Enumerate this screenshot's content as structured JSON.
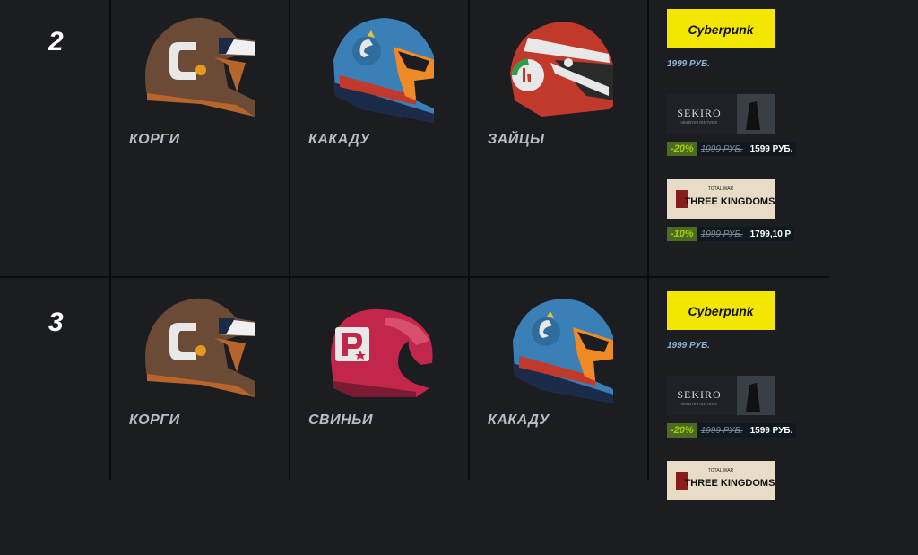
{
  "rows": [
    {
      "rank": "2",
      "teams": [
        {
          "name": "КОРГИ",
          "helmet": "corgi"
        },
        {
          "name": "КАКАДУ",
          "helmet": "cockatoo"
        },
        {
          "name": "ЗАЙЦЫ",
          "helmet": "hares"
        }
      ],
      "games": [
        {
          "title": "Cyberpunk",
          "price": "1999 РУБ.",
          "discount": "",
          "old_price": "",
          "new_price": ""
        },
        {
          "title": "SEKIRO",
          "subtitle": "SHADOWS DIE TWICE",
          "price": "",
          "discount": "-20%",
          "old_price": "1999 РУБ.",
          "new_price": "1599 РУБ."
        },
        {
          "title": "THREE KINGDOMS",
          "subtitle": "TOTAL WAR",
          "price": "",
          "discount": "-10%",
          "old_price": "1999 РУБ.",
          "new_price": "1799,10 Р"
        }
      ]
    },
    {
      "rank": "3",
      "teams": [
        {
          "name": "КОРГИ",
          "helmet": "corgi"
        },
        {
          "name": "СВИНЬИ",
          "helmet": "pigs"
        },
        {
          "name": "КАКАДУ",
          "helmet": "cockatoo"
        }
      ],
      "games": [
        {
          "title": "Cyberpunk",
          "price": "1999 РУБ.",
          "discount": "",
          "old_price": "",
          "new_price": ""
        },
        {
          "title": "SEKIRO",
          "subtitle": "SHADOWS DIE TWICE",
          "price": "",
          "discount": "-20%",
          "old_price": "1999 РУБ.",
          "new_price": "1599 РУБ."
        },
        {
          "title": "THREE KINGDOMS",
          "subtitle": "TOTAL WAR",
          "price": "",
          "discount": "",
          "old_price": "",
          "new_price": ""
        }
      ]
    }
  ],
  "colors": {
    "background": "#1b1d20",
    "discount_bg": "#4c6b22",
    "discount_text": "#a4d007",
    "price_blue": "#8fb3d6"
  }
}
